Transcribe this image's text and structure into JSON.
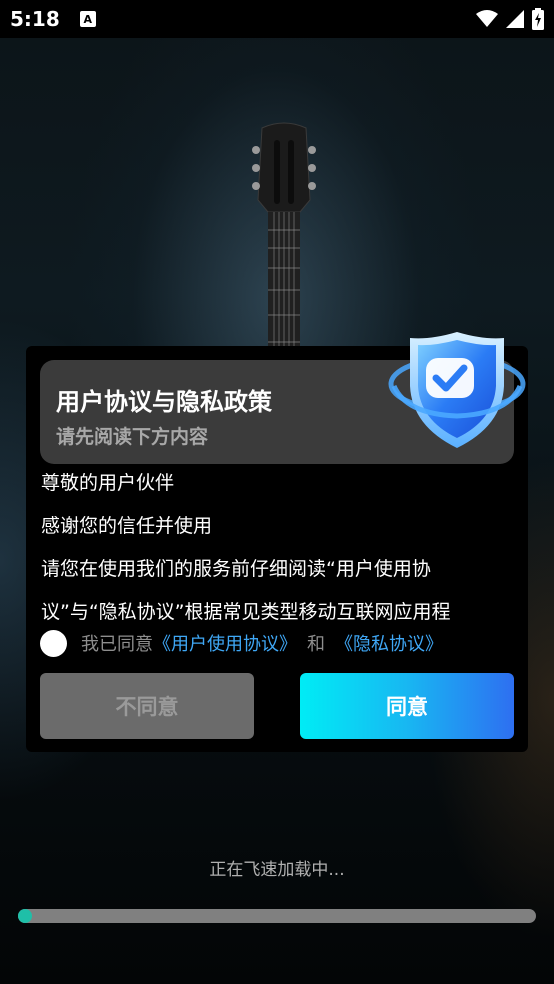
{
  "status_bar": {
    "time": "5:18",
    "notification_icon": "A",
    "icons": [
      "wifi-icon",
      "signal-icon",
      "battery-charging-icon"
    ]
  },
  "dialog": {
    "title": "用户协议与隐私政策",
    "subtitle": "请先阅读下方内容",
    "paragraphs": [
      "尊敬的用户伙伴",
      "感谢您的信任并使用",
      "请您在使用我们的服务前仔细阅读“用户使用协",
      "议”与“隐私协议”根据常见类型移动互联网应用程"
    ],
    "agree_prefix": "我已同意",
    "user_agreement_link": "《用户使用协议》",
    "and_text": "和",
    "privacy_link": "《隐私协议》",
    "disagree_button": "不同意",
    "agree_button": "同意"
  },
  "loading": {
    "text": "正在飞速加载中...",
    "progress": 0.02
  },
  "colors": {
    "accent_link": "#3fa7f5",
    "agree_gradient_start": "#00ecf5",
    "agree_gradient_end": "#2e6ff1",
    "progress_fill": "#1fbfa8"
  }
}
